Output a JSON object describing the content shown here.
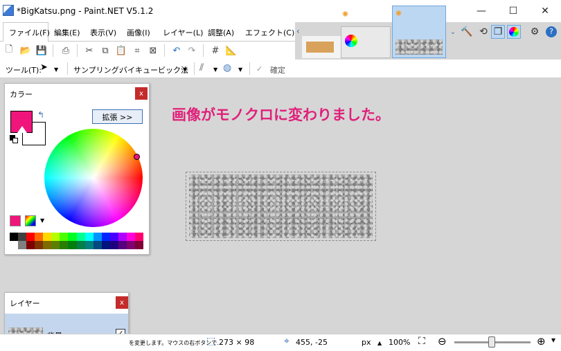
{
  "window": {
    "title": "*BigKatsu.png - Paint.NET V5.1.2",
    "minimize": "—",
    "maximize": "☐",
    "close": "✕"
  },
  "menu": {
    "items": [
      "ファイル(F)",
      "編集(E)",
      "表示(V)",
      "画像(I)",
      "レイヤー(L)",
      "調整(A)",
      "エフェクト(C)"
    ]
  },
  "tool_options": {
    "tool_label": "ツール(T):",
    "sampling_label": "サンプリング:",
    "sampling_value": "バイキュービック法",
    "confirm_label": "確定"
  },
  "annotation": "画像がモノクロに変わりました。",
  "color_panel": {
    "title": "カラー",
    "close": "x",
    "expand_button": "拡張 >>",
    "primary_color": "#f0157a",
    "secondary_color": "#ffffff",
    "palette": [
      "#000000",
      "#404040",
      "#ff0000",
      "#ff6a00",
      "#ffd800",
      "#b6ff00",
      "#4cff00",
      "#00ff21",
      "#00ff90",
      "#00ffff",
      "#0094ff",
      "#0026ff",
      "#4800ff",
      "#b200ff",
      "#ff00dc",
      "#ff006e",
      "#ffffff",
      "#808080",
      "#7f0000",
      "#7f3300",
      "#7f6a00",
      "#5b7f00",
      "#267f00",
      "#007f0e",
      "#007f46",
      "#007f7f",
      "#004a7f",
      "#00137f",
      "#21007f",
      "#57007f",
      "#7f006e",
      "#7f0037"
    ]
  },
  "layers_panel": {
    "title": "レイヤー",
    "close": "x",
    "layer_name": "背景",
    "layer_visible": "✓"
  },
  "status": {
    "hint": "を変更します。マウスの右ボタンで...",
    "selection_size": "273 × 98",
    "cursor_pos": "455, -25",
    "unit": "px",
    "zoom": "100%"
  },
  "colors": {
    "accent": "#f0157a",
    "selected_thumb_bg": "#bcd7f2",
    "link_blue": "#3c6fb5"
  }
}
